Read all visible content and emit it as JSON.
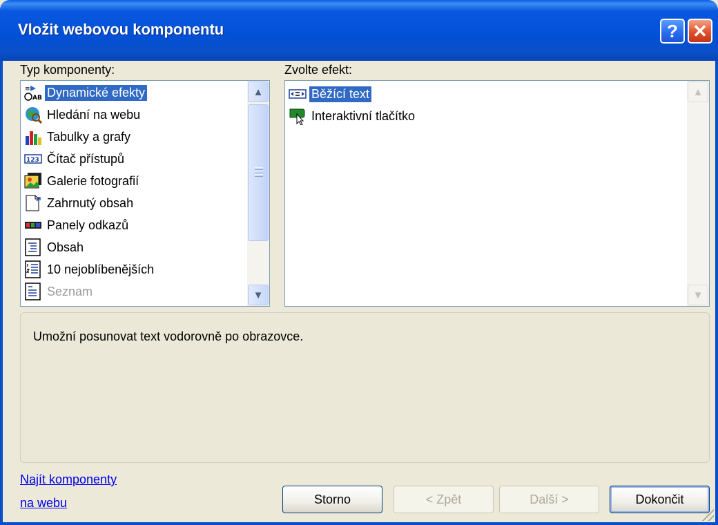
{
  "window": {
    "title": "Vložit webovou komponentu"
  },
  "component_types": {
    "label": "Typ komponenty:",
    "items": [
      {
        "label": "Dynamické efekty",
        "icon": "dynamic-effects-icon",
        "selected": true
      },
      {
        "label": "Hledání na webu",
        "icon": "web-search-icon"
      },
      {
        "label": "Tabulky a grafy",
        "icon": "charts-icon"
      },
      {
        "label": "Čítač přístupů",
        "icon": "hit-counter-icon"
      },
      {
        "label": "Galerie fotografií",
        "icon": "photo-gallery-icon"
      },
      {
        "label": "Zahrnutý obsah",
        "icon": "included-content-icon"
      },
      {
        "label": "Panely odkazů",
        "icon": "link-bar-icon"
      },
      {
        "label": "Obsah",
        "icon": "table-of-contents-icon"
      },
      {
        "label": "10 nejoblíbenějších",
        "icon": "top-ten-icon"
      },
      {
        "label": "Seznam",
        "icon": "list-icon",
        "disabled": true
      }
    ]
  },
  "effects": {
    "label": "Zvolte efekt:",
    "items": [
      {
        "label": "Běžící text",
        "icon": "marquee-icon",
        "selected": true
      },
      {
        "label": "Interaktivní tlačítko",
        "icon": "interactive-button-icon"
      }
    ]
  },
  "description": "Umožní posunovat text vodorovně po obrazovce.",
  "find_link": {
    "line1": "Najít komponenty",
    "line2": "na webu"
  },
  "buttons": {
    "cancel": "Storno",
    "back": "< Zpět",
    "next": "Další >",
    "finish": "Dokončit"
  },
  "colors": {
    "selection": "#316ac5",
    "titlebar": "#0a58e0",
    "dialog_bg": "#ece9d8"
  }
}
